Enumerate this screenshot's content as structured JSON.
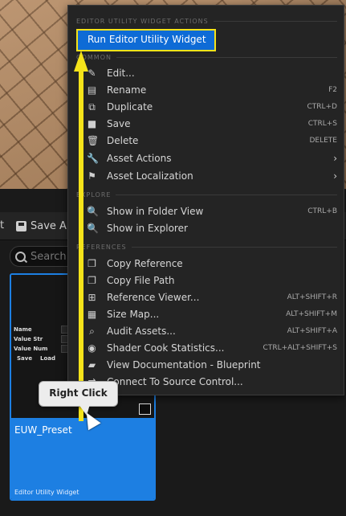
{
  "toolbar": {
    "left_fragment": "t",
    "save_all_label": "Save Al"
  },
  "search": {
    "placeholder": "Search"
  },
  "asset": {
    "name": "EUW_Preset",
    "type": "Editor Utility Widget",
    "thumbnail": {
      "row1": "Name",
      "row2": "Value Str",
      "row3": "Value Num",
      "btn_save": "Save",
      "btn_load": "Load"
    }
  },
  "menu": {
    "sections": {
      "actions": "EDITOR UTILITY WIDGET ACTIONS",
      "common": "COMMON",
      "explore": "EXPLORE",
      "references": "REFERENCES"
    },
    "run_label": "Run Editor Utility Widget",
    "items": [
      {
        "label": "Edit...",
        "shortcut": "",
        "icon": "pencil-icon"
      },
      {
        "label": "Rename",
        "shortcut": "F2",
        "icon": "rename-icon"
      },
      {
        "label": "Duplicate",
        "shortcut": "CTRL+D",
        "icon": "duplicate-icon"
      },
      {
        "label": "Save",
        "shortcut": "CTRL+S",
        "icon": "save-icon"
      },
      {
        "label": "Delete",
        "shortcut": "DELETE",
        "icon": "trash-icon"
      },
      {
        "label": "Asset Actions",
        "shortcut": "",
        "icon": "wrench-icon"
      },
      {
        "label": "Asset Localization",
        "shortcut": "",
        "icon": "flag-icon"
      },
      {
        "label": "Show in Folder View",
        "shortcut": "CTRL+B",
        "icon": "folder-search-icon"
      },
      {
        "label": "Show in Explorer",
        "shortcut": "",
        "icon": "folder-search-icon"
      },
      {
        "label": "Copy Reference",
        "shortcut": "",
        "icon": "copy-icon"
      },
      {
        "label": "Copy File Path",
        "shortcut": "",
        "icon": "copy-icon"
      },
      {
        "label": "Reference Viewer...",
        "shortcut": "ALT+SHIFT+R",
        "icon": "reference-viewer-icon"
      },
      {
        "label": "Size Map...",
        "shortcut": "ALT+SHIFT+M",
        "icon": "size-map-icon"
      },
      {
        "label": "Audit Assets...",
        "shortcut": "ALT+SHIFT+A",
        "icon": "audit-icon"
      },
      {
        "label": "Shader Cook Statistics...",
        "shortcut": "CTRL+ALT+SHIFT+S",
        "icon": "shader-icon"
      },
      {
        "label": "View Documentation - Blueprint",
        "shortcut": "",
        "icon": "book-icon"
      },
      {
        "label": "Connect To Source Control...",
        "shortcut": "",
        "icon": "source-control-icon"
      }
    ]
  },
  "callout": {
    "label": "Right Click"
  },
  "colors": {
    "accent": "#0e6bd6",
    "highlight": "#f5e31a",
    "menu_bg": "#242424",
    "tile_blue": "#1d7fe2"
  }
}
